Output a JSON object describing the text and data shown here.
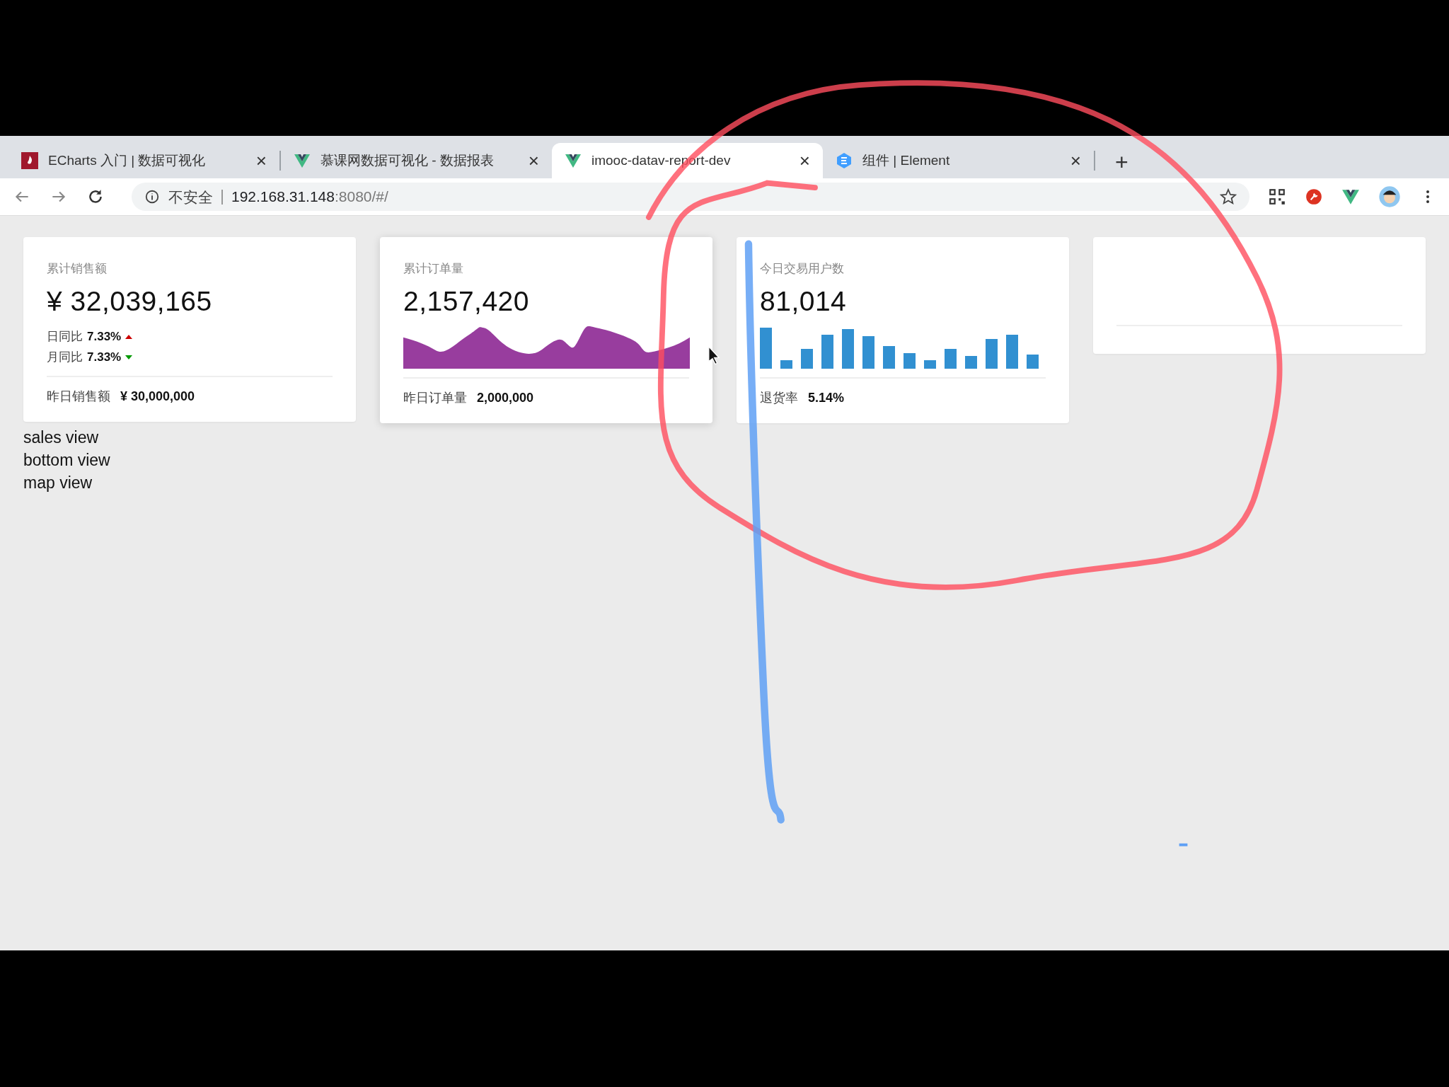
{
  "browser": {
    "tabs": [
      {
        "title": "ECharts 入门 | 数据可视化",
        "kind": "echarts",
        "selected": false
      },
      {
        "title": "慕课网数据可视化 - 数据报表",
        "kind": "vue",
        "selected": false
      },
      {
        "title": "imooc-datav-report-dev",
        "kind": "vue",
        "selected": true
      },
      {
        "title": "组件 | Element",
        "kind": "element",
        "selected": false
      }
    ],
    "close_glyph": "×",
    "new_tab_glyph": "+",
    "address": {
      "security": "不安全",
      "host": "192.168.31.148",
      "rest": ":8080/#/"
    }
  },
  "cards": [
    {
      "kind": "sales",
      "title": "累计销售额",
      "value": "¥ 32,039,165",
      "compare": [
        {
          "label": "日同比",
          "value": "7.33%",
          "rising": true
        },
        {
          "label": "月同比",
          "value": "7.33%",
          "rising": false
        }
      ],
      "footer_label": "昨日销售额",
      "footer_value": "¥ 30,000,000"
    },
    {
      "kind": "area",
      "title": "累计订单量",
      "value": "2,157,420",
      "footer_label": "昨日订单量",
      "footer_value": "2,000,000"
    },
    {
      "kind": "bars",
      "title": "今日交易用户数",
      "value": "81,014",
      "footer_label": "退货率",
      "footer_value": "5.14%"
    },
    {
      "kind": "empty"
    }
  ],
  "views": [
    "sales view",
    "bottom view",
    "map view"
  ]
}
